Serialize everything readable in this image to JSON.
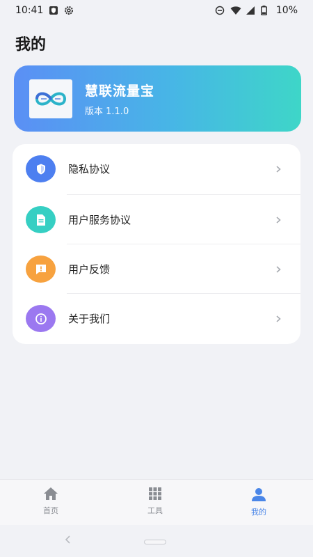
{
  "status_bar": {
    "time": "10:41",
    "battery": "10%"
  },
  "page": {
    "title": "我的"
  },
  "app_card": {
    "name": "慧联流量宝",
    "version": "版本 1.1.0",
    "gradient": [
      "#5b8ff5",
      "#3ed6c8"
    ]
  },
  "menu": {
    "items": [
      {
        "label": "隐私协议",
        "icon": "shield-icon",
        "color": "#4d7ff0"
      },
      {
        "label": "用户服务协议",
        "icon": "document-icon",
        "color": "#36cfc3"
      },
      {
        "label": "用户反馈",
        "icon": "feedback-icon",
        "color": "#f7a23f"
      },
      {
        "label": "关于我们",
        "icon": "info-icon",
        "color": "#9b78f0"
      }
    ]
  },
  "bottom_nav": {
    "items": [
      {
        "label": "首页",
        "icon": "home-icon"
      },
      {
        "label": "工具",
        "icon": "grid-icon"
      },
      {
        "label": "我的",
        "icon": "person-icon",
        "active": true
      }
    ],
    "active_color": "#4a86e8"
  }
}
